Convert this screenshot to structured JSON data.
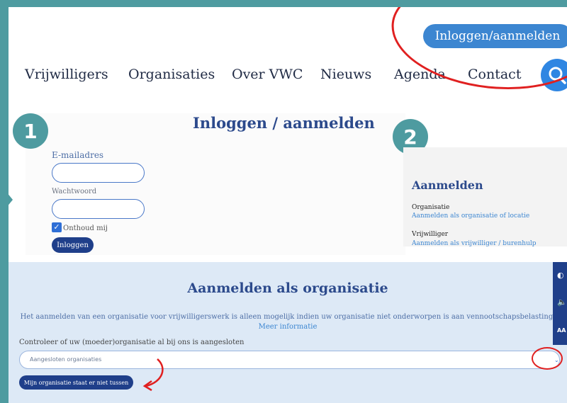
{
  "header": {
    "login_button": "Inloggen/aanmelden",
    "nav": [
      "Vrijwilligers",
      "Organisaties",
      "Over VWC",
      "Nieuws",
      "Agenda",
      "Contact"
    ],
    "search_icon": "search-icon"
  },
  "steps": [
    "1",
    "2"
  ],
  "login": {
    "title": "Inloggen / aanmelden",
    "email_label": "E-mailadres",
    "password_label": "Wachtwoord",
    "remember_label": "Onthoud mij",
    "submit": "Inloggen"
  },
  "register": {
    "title": "Aanmelden",
    "org_label": "Organisatie",
    "org_link": "Aanmelden als organisatie of locatie",
    "vol_label": "Vrijwilliger",
    "vol_link": "Aanmelden als vrijwilliger / burenhulp"
  },
  "org": {
    "title": "Aanmelden als organisatie",
    "description": "Het aanmelden van een organisatie voor vrijwilligerswerk is alleen mogelijk indien uw organisatie niet onderworpen is aan vennootschapsbelasting.",
    "more": "Meer informatie",
    "check_text": "Controleer of uw (moeder)organisatie al bij ons is aangesloten",
    "select_value": "Aangesloten organisaties",
    "missing_button": "Mijn organisatie staat er niet tussen"
  },
  "side_tools": [
    "◐",
    "🔈",
    "AA"
  ],
  "colors": {
    "teal": "#4e9ba0",
    "navy": "#1f3f8a",
    "blue": "#3c86d1",
    "light_blue_bg": "#dde9f6",
    "annotation_red": "#e02020"
  }
}
